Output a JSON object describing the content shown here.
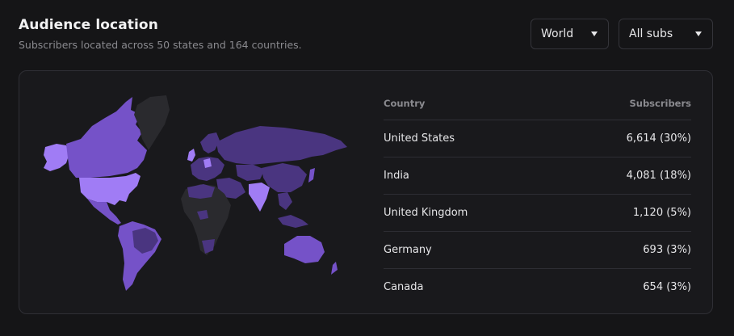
{
  "header": {
    "title": "Audience location",
    "subtitle": "Subscribers located across 50 states and 164 countries."
  },
  "filters": {
    "region": "World",
    "subscribers": "All subs"
  },
  "table": {
    "col_country": "Country",
    "col_subscribers": "Subscribers",
    "rows": [
      {
        "country": "United States",
        "value": "6,614 (30%)"
      },
      {
        "country": "India",
        "value": "4,081 (18%)"
      },
      {
        "country": "United Kingdom",
        "value": "1,120 (5%)"
      },
      {
        "country": "Germany",
        "value": "693 (3%)"
      },
      {
        "country": "Canada",
        "value": "654 (3%)"
      }
    ]
  },
  "colors": {
    "page_bg": "#151517",
    "card_bg": "#19191c",
    "accent_high": "#a07cf5",
    "accent_mid": "#7552c8",
    "accent_low": "#4a3580",
    "no_data": "#2a2a2e"
  },
  "icons": {
    "dropdown": "chevron-down-icon"
  }
}
